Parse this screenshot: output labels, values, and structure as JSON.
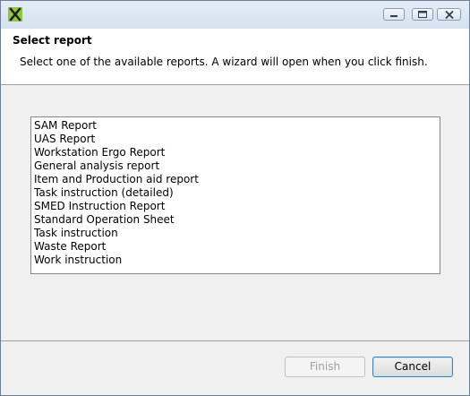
{
  "window": {
    "icon": "app-logo-icon",
    "controls": {
      "minimize": "minimize-icon",
      "maximize": "maximize-icon",
      "close": "close-icon"
    }
  },
  "header": {
    "title": "Select report",
    "description": "Select one of the available reports. A wizard will open when you click finish."
  },
  "reports": [
    "SAM Report",
    "UAS Report",
    "Workstation Ergo Report",
    "General analysis report",
    "Item and Production aid report",
    "Task instruction (detailed)",
    "SMED Instruction Report",
    "Standard Operation Sheet",
    "Task instruction",
    "Waste Report",
    "Work instruction"
  ],
  "buttons": {
    "finish": "Finish",
    "cancel": "Cancel"
  },
  "colors": {
    "logo": "#8dc63f",
    "header_bg": "#ffffff",
    "dialog_bg": "#f0f0f0"
  }
}
